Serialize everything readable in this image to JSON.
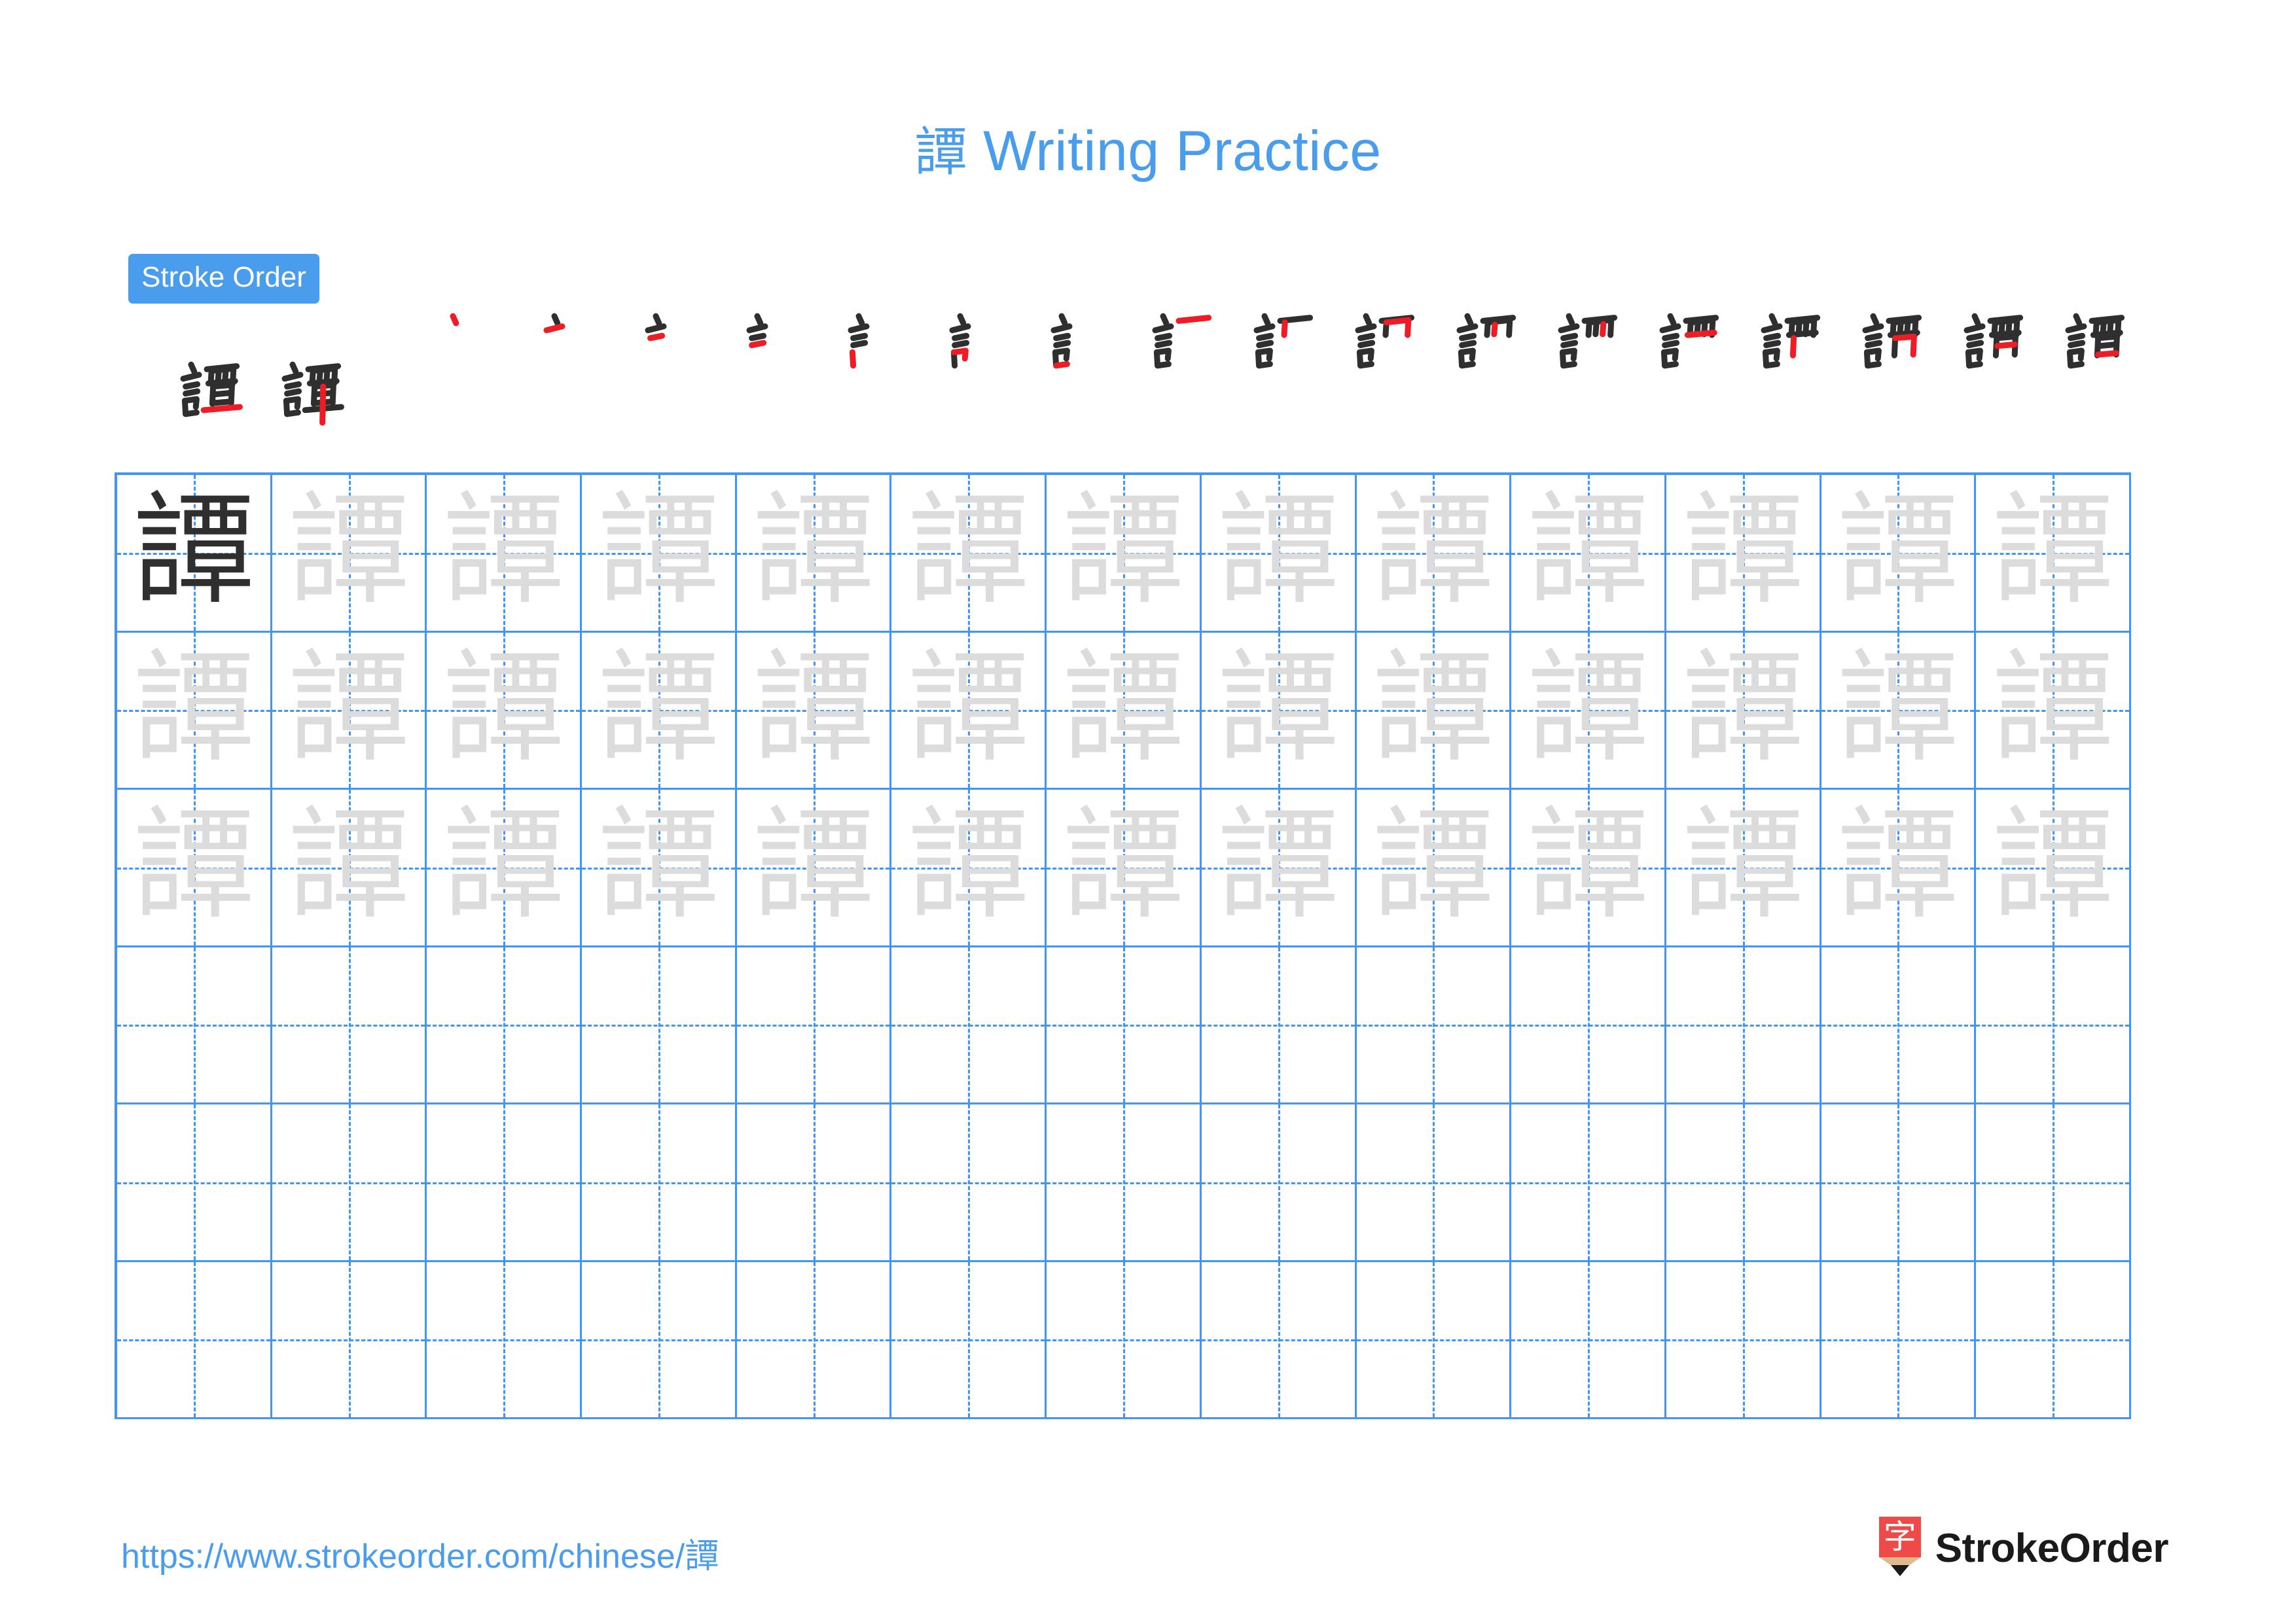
{
  "page": {
    "character": "譚",
    "title_suffix": " Writing Practice",
    "title_full": "譚 Writing Practice"
  },
  "colors": {
    "accent_blue": "#4a9ced",
    "grid_blue": "#4195f7",
    "stroke_done": "#2f2f2f",
    "stroke_new": "#ee1c25",
    "trace_gray": "#dcdcdc",
    "logo_red": "#ee4b48",
    "logo_wood": "#e0b98f"
  },
  "stroke_order": {
    "badge_label": "Stroke Order",
    "total_strokes": 19,
    "row1_count": 17,
    "row2_count": 2,
    "frames": [
      {
        "index": 1,
        "new_stroke": "dot"
      },
      {
        "index": 2,
        "new_stroke": "horizontal"
      },
      {
        "index": 3,
        "new_stroke": "horizontal"
      },
      {
        "index": 4,
        "new_stroke": "horizontal"
      },
      {
        "index": 5,
        "new_stroke": "vertical"
      },
      {
        "index": 6,
        "new_stroke": "horizontal-fold"
      },
      {
        "index": 7,
        "new_stroke": "horizontal"
      },
      {
        "index": 8,
        "new_stroke": "horizontal"
      },
      {
        "index": 9,
        "new_stroke": "vertical"
      },
      {
        "index": 10,
        "new_stroke": "horizontal-fold"
      },
      {
        "index": 11,
        "new_stroke": "vertical"
      },
      {
        "index": 12,
        "new_stroke": "vertical"
      },
      {
        "index": 13,
        "new_stroke": "horizontal"
      },
      {
        "index": 14,
        "new_stroke": "vertical"
      },
      {
        "index": 15,
        "new_stroke": "horizontal-fold"
      },
      {
        "index": 16,
        "new_stroke": "horizontal"
      },
      {
        "index": 17,
        "new_stroke": "horizontal"
      },
      {
        "index": 18,
        "new_stroke": "horizontal"
      },
      {
        "index": 19,
        "new_stroke": "vertical"
      }
    ]
  },
  "practice_grid": {
    "columns": 13,
    "rows": 6,
    "filled_rows": 3,
    "model_cell_index": 0,
    "model_character": "譚",
    "trace_character": "譚",
    "empty_rows": 3
  },
  "footer": {
    "url": "https://www.strokeorder.com/chinese/譚",
    "brand_name": "StrokeOrder",
    "logo_glyph": "字"
  }
}
